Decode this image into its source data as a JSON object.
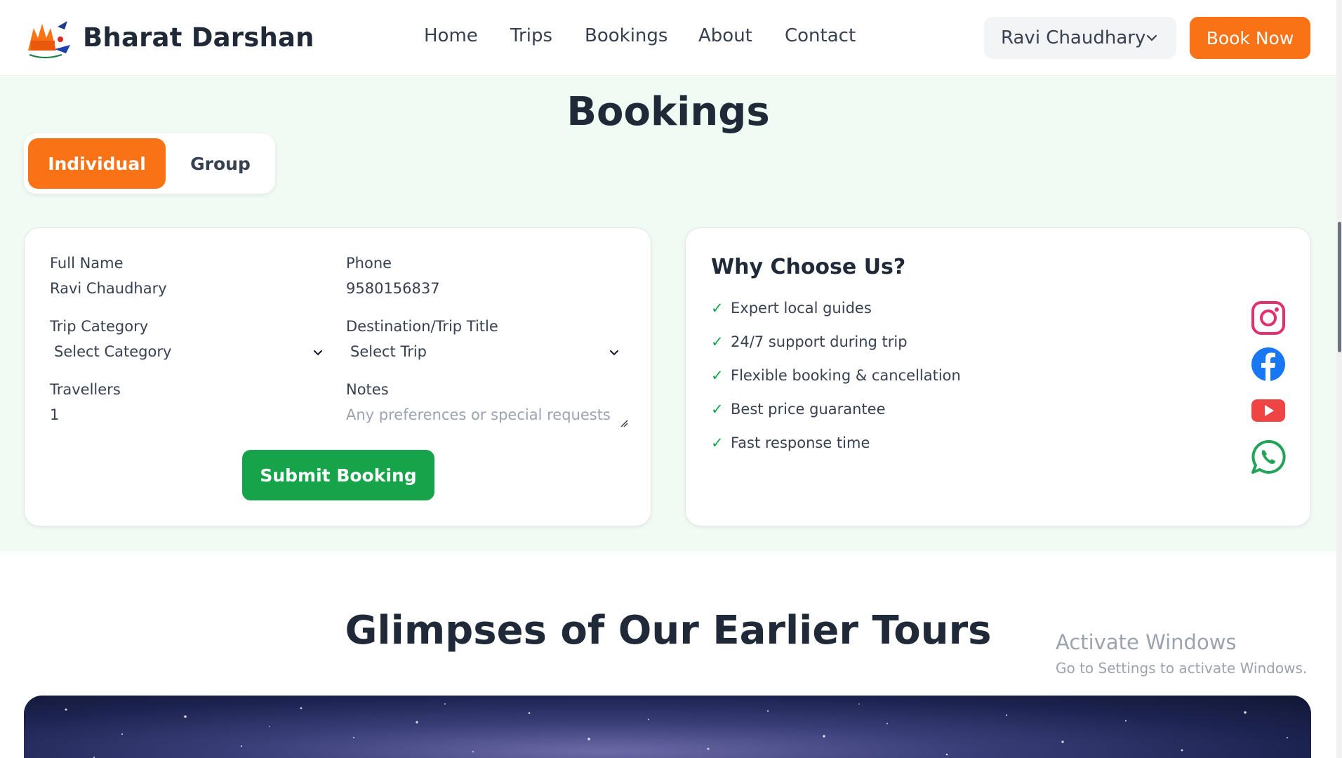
{
  "header": {
    "brand": "Bharat Darshan",
    "nav": [
      "Home",
      "Trips",
      "Bookings",
      "About",
      "Contact"
    ],
    "user_name": "Ravi Chaudhary",
    "book_now": "Book Now"
  },
  "bookings": {
    "title": "Bookings",
    "tabs": {
      "individual": "Individual",
      "group": "Group",
      "active": "Individual"
    },
    "form": {
      "full_name_label": "Full Name",
      "full_name_value": "Ravi Chaudhary",
      "phone_label": "Phone",
      "phone_value": "9580156837",
      "trip_category_label": "Trip Category",
      "trip_category_value": "Select Category",
      "destination_label": "Destination/Trip Title",
      "destination_value": "Select Trip",
      "travellers_label": "Travellers",
      "travellers_value": "1",
      "notes_label": "Notes",
      "notes_placeholder": "Any preferences or special requests",
      "submit": "Submit Booking"
    },
    "why": {
      "title": "Why Choose Us?",
      "items": [
        "Expert local guides",
        "24/7 support during trip",
        "Flexible booking & cancellation",
        "Best price guarantee",
        "Fast response time"
      ],
      "socials": [
        "instagram-icon",
        "facebook-icon",
        "youtube-icon",
        "whatsapp-icon"
      ]
    }
  },
  "glimpses": {
    "title": "Glimpses of Our Earlier Tours"
  },
  "os_watermark": {
    "line1": "Activate Windows",
    "line2": "Go to Settings to activate Windows."
  },
  "colors": {
    "accent": "#f97316",
    "success": "#16a34a",
    "section_bg": "#effbf3"
  }
}
